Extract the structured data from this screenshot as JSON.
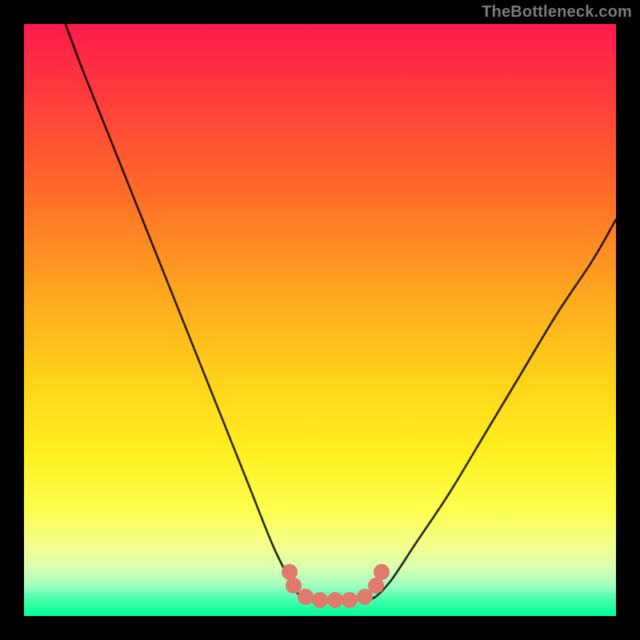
{
  "watermark": {
    "text": "TheBottleneck.com"
  },
  "colors": {
    "frame": "#000000",
    "gradient_top": "#ff1a4d",
    "gradient_bottom": "#00ff99",
    "curve": "#000000",
    "dot": "#e07a6e",
    "watermark": "#7a7a7a"
  },
  "chart_data": {
    "type": "line",
    "title": "",
    "xlabel": "",
    "ylabel": "",
    "xlim": [
      0,
      100
    ],
    "ylim": [
      0,
      100
    ],
    "note": "Values are read from the figure in percent-of-axis units; y=100 is top, y=0 is bottom. Two descending arcs meet in a flat minimum near y≈3.",
    "series": [
      {
        "name": "left-curve",
        "x": [
          7,
          10,
          14,
          18,
          22,
          26,
          30,
          34,
          38,
          42,
          45,
          47
        ],
        "y": [
          100,
          92,
          82,
          72,
          62,
          52,
          42,
          32,
          22,
          12,
          6,
          3
        ]
      },
      {
        "name": "valley-floor",
        "x": [
          47,
          50,
          53,
          56,
          59
        ],
        "y": [
          3,
          2.7,
          2.7,
          2.7,
          3
        ]
      },
      {
        "name": "right-curve",
        "x": [
          59,
          62,
          66,
          72,
          78,
          84,
          90,
          96,
          100
        ],
        "y": [
          3,
          6,
          12,
          21,
          31,
          41,
          51,
          60,
          67
        ]
      }
    ],
    "dots": {
      "name": "highlight-dots",
      "x": [
        44.8,
        45.6,
        47.5,
        50.0,
        52.5,
        55.0,
        57.5,
        59.4,
        60.4
      ],
      "y": [
        7.5,
        5.2,
        3.2,
        2.7,
        2.7,
        2.7,
        3.2,
        5.2,
        7.5
      ]
    }
  }
}
